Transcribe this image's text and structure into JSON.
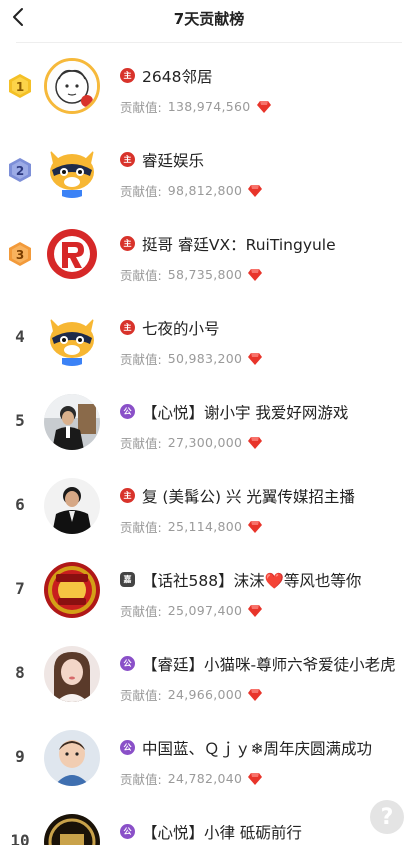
{
  "header": {
    "title": "7天贡献榜",
    "back_icon": "chevron-left-icon"
  },
  "score_label": "贡献值:",
  "colors": {
    "role_red": "#d8332b",
    "role_purple": "#8a50c8",
    "gem": "#e8342a",
    "rank_gold": "#f4c026",
    "rank_silver": "#7d8fd8",
    "rank_bronze": "#f29a3a"
  },
  "rows": [
    {
      "rank": "1",
      "role": "主",
      "role_color": "red",
      "name": "2648邻居",
      "score": "138,974,560"
    },
    {
      "rank": "2",
      "role": "主",
      "role_color": "red",
      "name": "睿廷娱乐",
      "score": "98,812,800"
    },
    {
      "rank": "3",
      "role": "主",
      "role_color": "red",
      "name": "挺哥 睿廷VX：RuiTingyule",
      "score": "58,735,800"
    },
    {
      "rank": "4",
      "role": "主",
      "role_color": "red",
      "name": "七夜的小号",
      "score": "50,983,200"
    },
    {
      "rank": "5",
      "role": "公",
      "role_color": "purple",
      "name": "【心悦】谢小宇 我爱好网游戏",
      "score": "27,300,000"
    },
    {
      "rank": "6",
      "role": "主",
      "role_color": "red",
      "name": "复 (美髯公) 兴 光翼传媒招主播",
      "score": "25,114,800"
    },
    {
      "rank": "7",
      "role": "嘉",
      "role_color": "dark",
      "name": "【话社588】沫沫❤️等风也等你",
      "score": "25,097,400"
    },
    {
      "rank": "8",
      "role": "公",
      "role_color": "purple",
      "name": "【睿廷】小猫咪-尊师六爷爱徒小老虎",
      "score": "24,966,000"
    },
    {
      "rank": "9",
      "role": "公",
      "role_color": "purple",
      "name": "中国蓝、Ｑｊｙ❄周年庆圆满成功",
      "score": "24,782,040"
    },
    {
      "rank": "10",
      "role": "公",
      "role_color": "purple",
      "name": "【心悦】小律 砥砺前行",
      "score": ""
    }
  ],
  "help_label": "?"
}
